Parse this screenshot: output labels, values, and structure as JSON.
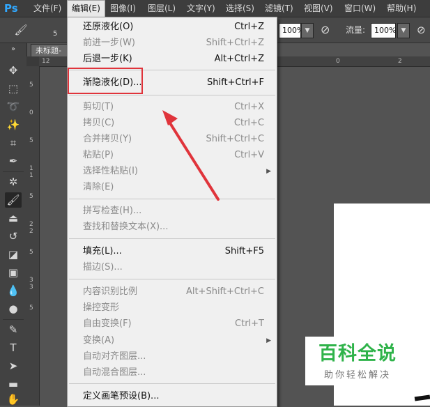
{
  "app": {
    "logo": "Ps"
  },
  "menubar": {
    "items": [
      {
        "label": "文件(F)"
      },
      {
        "label": "编辑(E)"
      },
      {
        "label": "图像(I)"
      },
      {
        "label": "图层(L)"
      },
      {
        "label": "文字(Y)"
      },
      {
        "label": "选择(S)"
      },
      {
        "label": "滤镜(T)"
      },
      {
        "label": "视图(V)"
      },
      {
        "label": "窗口(W)"
      },
      {
        "label": "帮助(H)"
      }
    ]
  },
  "options": {
    "brush_size": "5",
    "opacity_value": "100%",
    "flow_label": "流量:",
    "flow_value": "100%"
  },
  "document": {
    "tab_title": "未标题-",
    "ruler_top": [
      "12",
      "0",
      "2"
    ],
    "ruler_left": [
      "5",
      "0",
      "5",
      "1",
      "1",
      "5",
      "2",
      "2",
      "5",
      "3",
      "3",
      "5"
    ]
  },
  "edit_menu": {
    "items": [
      {
        "label": "还原液化(O)",
        "shortcut": "Ctrl+Z",
        "disabled": false
      },
      {
        "label": "前进一步(W)",
        "shortcut": "Shift+Ctrl+Z",
        "disabled": true
      },
      {
        "label": "后退一步(K)",
        "shortcut": "Alt+Ctrl+Z",
        "disabled": false
      },
      {
        "label": "渐隐液化(D)...",
        "shortcut": "Shift+Ctrl+F",
        "disabled": false
      },
      {
        "label": "剪切(T)",
        "shortcut": "Ctrl+X",
        "disabled": true
      },
      {
        "label": "拷贝(C)",
        "shortcut": "Ctrl+C",
        "disabled": true
      },
      {
        "label": "合并拷贝(Y)",
        "shortcut": "Shift+Ctrl+C",
        "disabled": true
      },
      {
        "label": "粘贴(P)",
        "shortcut": "Ctrl+V",
        "disabled": true
      },
      {
        "label": "选择性粘贴(I)",
        "shortcut": "",
        "disabled": true
      },
      {
        "label": "清除(E)",
        "shortcut": "",
        "disabled": true
      },
      {
        "label": "拼写检查(H)...",
        "shortcut": "",
        "disabled": true
      },
      {
        "label": "查找和替换文本(X)...",
        "shortcut": "",
        "disabled": true
      },
      {
        "label": "填充(L)...",
        "shortcut": "Shift+F5",
        "disabled": false
      },
      {
        "label": "描边(S)...",
        "shortcut": "",
        "disabled": true
      },
      {
        "label": "内容识别比例",
        "shortcut": "Alt+Shift+Ctrl+C",
        "disabled": true
      },
      {
        "label": "操控变形",
        "shortcut": "",
        "disabled": true
      },
      {
        "label": "自由变换(F)",
        "shortcut": "Ctrl+T",
        "disabled": true
      },
      {
        "label": "变换(A)",
        "shortcut": "",
        "disabled": true
      },
      {
        "label": "自动对齐图层...",
        "shortcut": "",
        "disabled": true
      },
      {
        "label": "自动混合图层...",
        "shortcut": "",
        "disabled": true
      },
      {
        "label": "定义画笔预设(B)...",
        "shortcut": "",
        "disabled": false
      }
    ]
  },
  "watermark": {
    "title": "百科全说",
    "subtitle": "助你轻松解决"
  },
  "colors": {
    "highlight": "#e0343b",
    "watermark_green": "#2fb34a",
    "ps_blue": "#31a8ff"
  }
}
